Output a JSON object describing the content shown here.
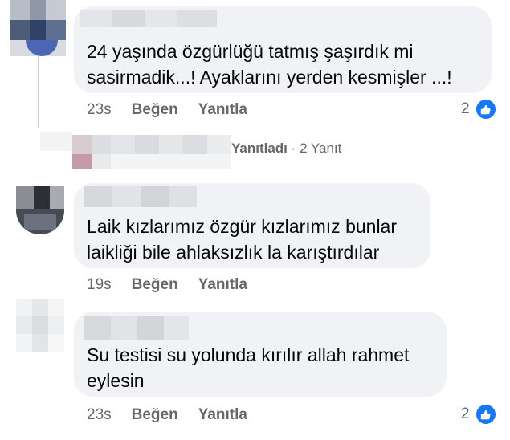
{
  "comments": [
    {
      "text": "24 yaşında özgürlüğü tatmış şaşırdık mi\nsasirmadik...! Ayaklarını yerden kesmişler ...!",
      "time": "23s",
      "like_label": "Beğen",
      "reply_label": "Yanıtla",
      "reaction_count": "2",
      "reaction_icon": "like-icon",
      "accent": "#1877f2"
    },
    {
      "text": "Laik kızlarımız özgür kızlarımız bunlar\nlaikliği bile ahlaksızlık la karıştırdılar",
      "time": "19s",
      "like_label": "Beğen",
      "reply_label": "Yanıtla"
    },
    {
      "text": "Su testisi su yolunda kırılır allah rahmet\neylesin",
      "time": "23s",
      "like_label": "Beğen",
      "reply_label": "Yanıtla",
      "reaction_count": "2",
      "reaction_icon": "like-icon"
    }
  ],
  "reply_summary": {
    "action": "Yanıtladı",
    "separator": "·",
    "count_text": "2 Yanıt"
  },
  "colors": {
    "bubble": "#f0f2f5",
    "meta_text": "#65676b",
    "like_blue": "#1877f2"
  }
}
